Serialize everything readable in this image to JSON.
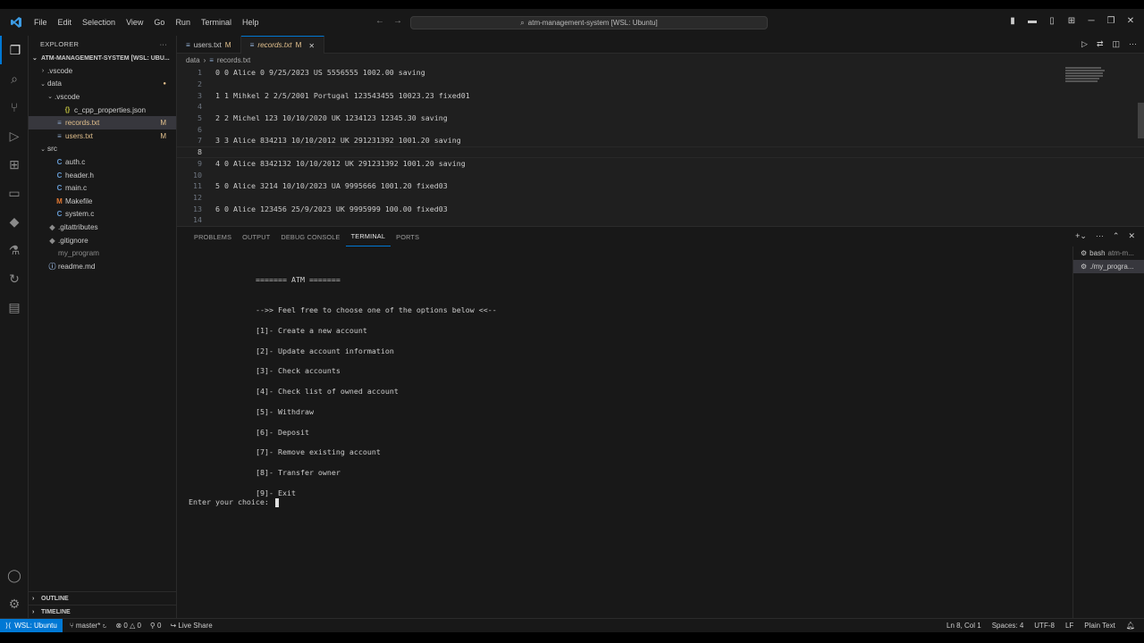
{
  "titlebar": {
    "menu": [
      "File",
      "Edit",
      "Selection",
      "View",
      "Go",
      "Run",
      "Terminal",
      "Help"
    ],
    "search": "atm-management-system [WSL: Ubuntu]"
  },
  "sidebar": {
    "title": "EXPLORER",
    "root": "ATM-MANAGEMENT-SYSTEM [WSL: UBU...",
    "items": [
      {
        "label": ".vscode",
        "type": "folder-closed",
        "indent": 1
      },
      {
        "label": "data",
        "type": "folder-open",
        "indent": 1,
        "dot": "●"
      },
      {
        "label": ".vscode",
        "type": "folder-open",
        "indent": 2
      },
      {
        "label": "c_cpp_properties.json",
        "type": "json",
        "indent": 3
      },
      {
        "label": "records.txt",
        "type": "txt",
        "indent": 2,
        "badge": "M",
        "selected": true
      },
      {
        "label": "users.txt",
        "type": "txt",
        "indent": 2,
        "badge": "M"
      },
      {
        "label": "src",
        "type": "folder-open",
        "indent": 1
      },
      {
        "label": "auth.c",
        "type": "c",
        "indent": 2
      },
      {
        "label": "header.h",
        "type": "c",
        "indent": 2
      },
      {
        "label": "main.c",
        "type": "c",
        "indent": 2
      },
      {
        "label": "Makefile",
        "type": "make",
        "indent": 2
      },
      {
        "label": "system.c",
        "type": "c",
        "indent": 2
      },
      {
        "label": ".gitattributes",
        "type": "git",
        "indent": 1
      },
      {
        "label": ".gitignore",
        "type": "git",
        "indent": 1
      },
      {
        "label": "my_program",
        "type": "file",
        "indent": 1,
        "dim": true
      },
      {
        "label": "readme.md",
        "type": "md",
        "indent": 1
      }
    ],
    "outline": "OUTLINE",
    "timeline": "TIMELINE"
  },
  "tabs": [
    {
      "label": "users.txt",
      "badge": "M",
      "active": false
    },
    {
      "label": "records.txt",
      "badge": "M",
      "active": true
    }
  ],
  "breadcrumb": [
    "data",
    "records.txt"
  ],
  "editor": {
    "lines": [
      "0 0 Alice 0 9/25/2023 US 5556555 1002.00 saving",
      "",
      "1 1 Mihkel 2 2/5/2001 Portugal 123543455 10023.23 fixed01",
      "",
      "2 2 Michel 123 10/10/2020 UK 1234123 12345.30 saving",
      "",
      "3 3 Alice 834213 10/10/2012 UK 291231392 1001.20 saving",
      "",
      "4 0 Alice 8342132 10/10/2012 UK 291231392 1001.20 saving",
      "",
      "5 0 Alice 3214 10/10/2023 UA 9995666 1001.20 fixed03",
      "",
      "6 0 Alice 123456 25/9/2023 UK 9995999 100.00 fixed03",
      ""
    ],
    "current_line": 8
  },
  "panel": {
    "tabs": [
      "PROBLEMS",
      "OUTPUT",
      "DEBUG CONSOLE",
      "TERMINAL",
      "PORTS"
    ],
    "active_tab": "TERMINAL",
    "terminal": {
      "header": "======= ATM =======",
      "prompt_line": "-->> Feel free to choose one of the options below <<--",
      "options": [
        "[1]- Create a new account",
        "[2]- Update account information",
        "[3]- Check accounts",
        "[4]- Check list of owned account",
        "[5]- Withdraw",
        "[6]- Deposit",
        "[7]- Remove existing account",
        "[8]- Transfer owner",
        "[9]- Exit"
      ],
      "input_prompt": "Enter your choice: "
    },
    "terminal_list": [
      {
        "label": "bash",
        "sub": "atm-m...",
        "active": false
      },
      {
        "label": "./my_progra...",
        "sub": "",
        "active": true
      }
    ]
  },
  "statusbar": {
    "remote": "WSL: Ubuntu",
    "branch": "master*",
    "errors": "0",
    "warnings": "0",
    "ports": "0",
    "liveshare": "Live Share",
    "position": "Ln 8, Col 1",
    "spaces": "Spaces: 4",
    "encoding": "UTF-8",
    "eol": "LF",
    "language": "Plain Text"
  },
  "colors": {
    "accent": "#0078d4",
    "modified": "#e2c08d"
  }
}
